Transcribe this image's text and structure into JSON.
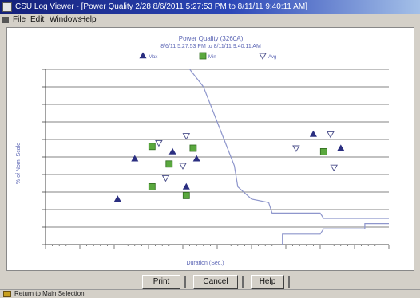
{
  "window": {
    "title": "CSU Log Viewer - [Power Quality 2/28 8/6/2011 5:27:53 PM to 8/11/11 9:40:11 AM]"
  },
  "menu": {
    "items": [
      "File",
      "Edit",
      "Windows",
      "Help"
    ]
  },
  "chart_data": {
    "type": "scatter",
    "title": "Power Quality (3260A)",
    "subtitle": "8/6/11 5:27:53 PM to 8/11/11 9:40:11 AM",
    "xlabel": "Duration (Sec.)",
    "ylabel": "% of Nom. Scale",
    "xlim": [
      0,
      10
    ],
    "ylim": [
      0,
      10
    ],
    "grid": true,
    "legend_position": "top",
    "tick_labels_legible": false,
    "series": [
      {
        "name": "Max",
        "marker": "triangle-up",
        "color": "#2a2e80",
        "points": [
          [
            2.1,
            2.6
          ],
          [
            2.6,
            4.9
          ],
          [
            3.7,
            5.3
          ],
          [
            4.1,
            3.3
          ],
          [
            4.4,
            4.9
          ],
          [
            7.8,
            6.3
          ],
          [
            8.6,
            5.5
          ]
        ]
      },
      {
        "name": "Min",
        "marker": "square",
        "color": "#5aa83e",
        "points": [
          [
            3.1,
            5.6
          ],
          [
            3.1,
            3.3
          ],
          [
            3.6,
            4.6
          ],
          [
            4.1,
            2.8
          ],
          [
            4.3,
            5.5
          ],
          [
            8.1,
            5.3
          ]
        ]
      },
      {
        "name": "Avg",
        "marker": "triangle-down",
        "color": "#4a4e8a",
        "points": [
          [
            3.3,
            5.8
          ],
          [
            3.5,
            3.8
          ],
          [
            4.0,
            4.5
          ],
          [
            4.1,
            6.2
          ],
          [
            7.3,
            5.5
          ],
          [
            8.3,
            6.3
          ],
          [
            8.4,
            4.4
          ]
        ]
      }
    ],
    "curves": [
      {
        "name": "",
        "color": "#8e96cc",
        "points": [
          [
            4.2,
            10
          ],
          [
            4.6,
            9
          ],
          [
            5.0,
            7
          ],
          [
            5.3,
            5.5
          ],
          [
            5.5,
            4.5
          ],
          [
            5.6,
            3.3
          ],
          [
            6.0,
            2.6
          ],
          [
            6.5,
            2.4
          ],
          [
            6.6,
            1.8
          ],
          [
            8.0,
            1.8
          ],
          [
            8.1,
            1.5
          ],
          [
            9.4,
            1.5
          ],
          [
            10.0,
            1.5
          ]
        ]
      },
      {
        "name": "",
        "color": "#8e96cc",
        "points": [
          [
            6.9,
            0
          ],
          [
            6.9,
            0.6
          ],
          [
            7.0,
            0.6
          ],
          [
            8.0,
            0.6
          ],
          [
            8.1,
            0.9
          ],
          [
            9.3,
            0.9
          ],
          [
            9.3,
            1.2
          ],
          [
            10.0,
            1.2
          ]
        ]
      }
    ]
  },
  "buttons": {
    "print": "Print",
    "cancel": "Cancel",
    "help": "Help"
  },
  "status": {
    "text": "Return to Main Selection"
  }
}
